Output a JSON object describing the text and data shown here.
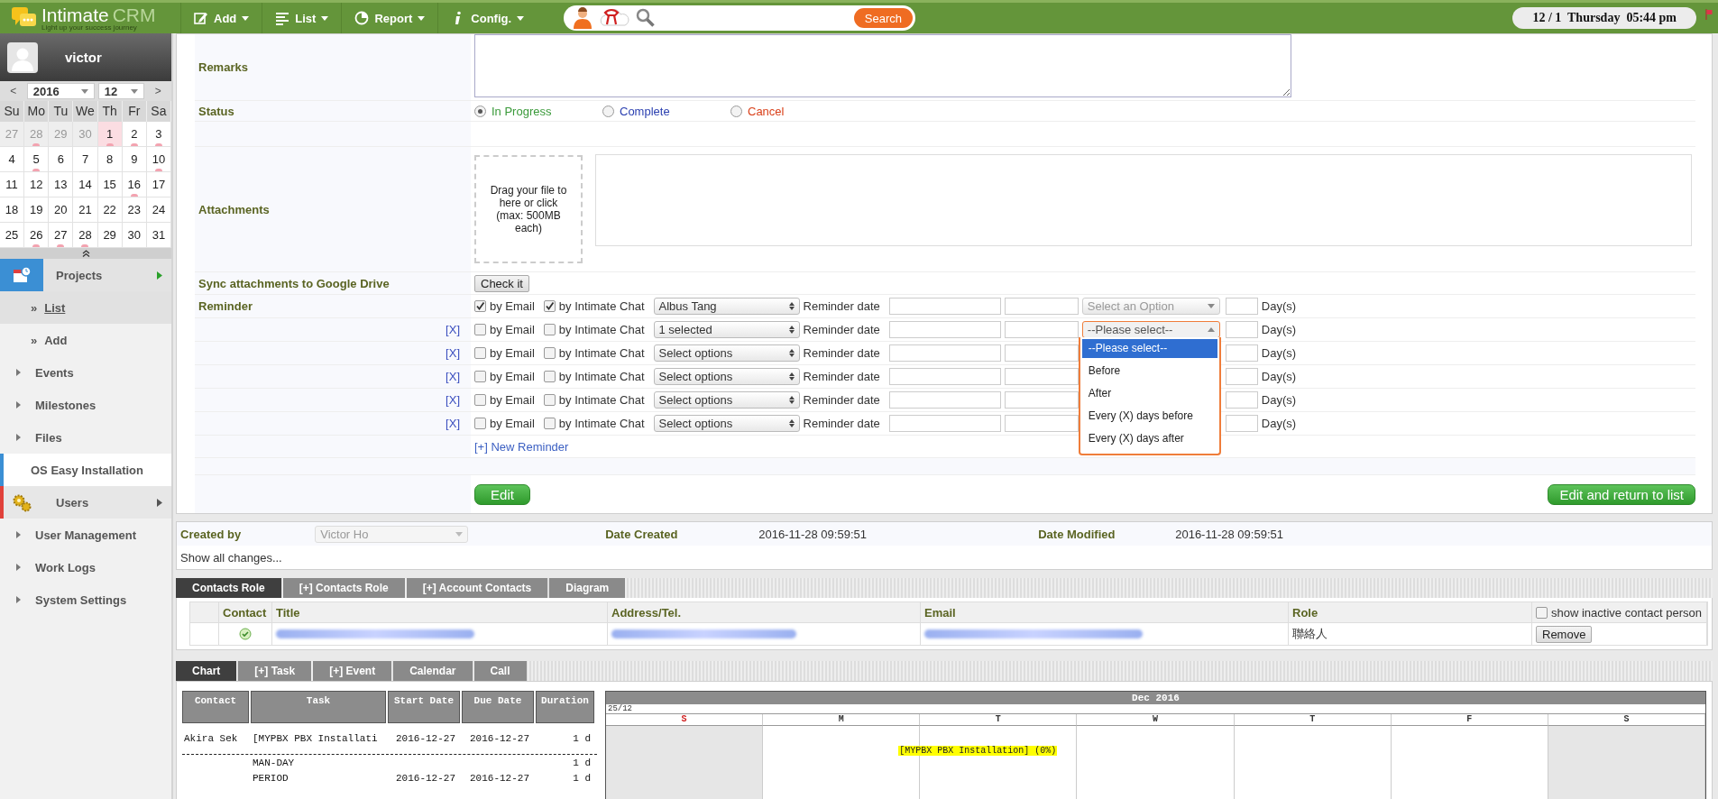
{
  "topbar": {
    "logo": {
      "name": "Intimate",
      "suffix": "CRM",
      "tagline": "Light up your success journey"
    },
    "menu": [
      {
        "label": "Add",
        "kind": "add"
      },
      {
        "label": "List",
        "kind": "list"
      },
      {
        "label": "Report",
        "kind": "report"
      },
      {
        "label": "Config.",
        "kind": "config"
      }
    ],
    "search": {
      "button": "Search"
    },
    "clock": "12 / 1  Thursday  05:44 pm"
  },
  "sidebar": {
    "user": "victor",
    "calendar": {
      "year": "2016",
      "month": "12",
      "prev": "<",
      "next": ">",
      "weekdays": [
        "Su",
        "Mo",
        "Tu",
        "We",
        "Th",
        "Fr",
        "Sa"
      ],
      "weeks": [
        [
          {
            "d": "27",
            "muted": true,
            "today": false,
            "event": false
          },
          {
            "d": "28",
            "muted": true,
            "today": false,
            "event": true
          },
          {
            "d": "29",
            "muted": true,
            "today": false,
            "event": false
          },
          {
            "d": "30",
            "muted": true,
            "today": false,
            "event": false
          },
          {
            "d": "1",
            "muted": false,
            "today": true,
            "event": true
          },
          {
            "d": "2",
            "muted": false,
            "today": false,
            "event": true
          },
          {
            "d": "3",
            "muted": false,
            "today": false,
            "event": true
          }
        ],
        [
          {
            "d": "4",
            "muted": false,
            "today": false,
            "event": false
          },
          {
            "d": "5",
            "muted": false,
            "today": false,
            "event": true
          },
          {
            "d": "6",
            "muted": false,
            "today": false,
            "event": false
          },
          {
            "d": "7",
            "muted": false,
            "today": false,
            "event": false
          },
          {
            "d": "8",
            "muted": false,
            "today": false,
            "event": false
          },
          {
            "d": "9",
            "muted": false,
            "today": false,
            "event": false
          },
          {
            "d": "10",
            "muted": false,
            "today": false,
            "event": true
          }
        ],
        [
          {
            "d": "11",
            "muted": false,
            "today": false,
            "event": false
          },
          {
            "d": "12",
            "muted": false,
            "today": false,
            "event": false
          },
          {
            "d": "13",
            "muted": false,
            "today": false,
            "event": false
          },
          {
            "d": "14",
            "muted": false,
            "today": false,
            "event": false
          },
          {
            "d": "15",
            "muted": false,
            "today": false,
            "event": false
          },
          {
            "d": "16",
            "muted": false,
            "today": false,
            "event": true
          },
          {
            "d": "17",
            "muted": false,
            "today": false,
            "event": false
          }
        ],
        [
          {
            "d": "18",
            "muted": false,
            "today": false,
            "event": false
          },
          {
            "d": "19",
            "muted": false,
            "today": false,
            "event": false
          },
          {
            "d": "20",
            "muted": false,
            "today": false,
            "event": false
          },
          {
            "d": "21",
            "muted": false,
            "today": false,
            "event": false
          },
          {
            "d": "22",
            "muted": false,
            "today": false,
            "event": false
          },
          {
            "d": "23",
            "muted": false,
            "today": false,
            "event": false
          },
          {
            "d": "24",
            "muted": false,
            "today": false,
            "event": false
          }
        ],
        [
          {
            "d": "25",
            "muted": false,
            "today": false,
            "event": false
          },
          {
            "d": "26",
            "muted": false,
            "today": false,
            "event": true
          },
          {
            "d": "27",
            "muted": false,
            "today": false,
            "event": true
          },
          {
            "d": "28",
            "muted": false,
            "today": false,
            "event": true
          },
          {
            "d": "29",
            "muted": false,
            "today": false,
            "event": false
          },
          {
            "d": "30",
            "muted": false,
            "today": false,
            "event": false
          },
          {
            "d": "31",
            "muted": false,
            "today": false,
            "event": false
          }
        ]
      ]
    },
    "items": [
      {
        "label": "Projects",
        "kind": "section",
        "expanded": true,
        "selected": false,
        "color": "#3b8fd4"
      },
      {
        "label": "List",
        "kind": "sub",
        "bullet": "»",
        "selected": true
      },
      {
        "label": "Add",
        "kind": "sub",
        "bullet": "»",
        "selected": false
      },
      {
        "label": "Events",
        "kind": "item",
        "selected": false
      },
      {
        "label": "Milestones",
        "kind": "item",
        "selected": false
      },
      {
        "label": "Files",
        "kind": "item",
        "selected": false
      },
      {
        "label": "OS Easy Installation",
        "kind": "current",
        "selected": false,
        "color": "#3b8fd4"
      },
      {
        "label": "Users",
        "kind": "section",
        "expanded": false,
        "selected": false,
        "color": "#e0413a"
      },
      {
        "label": "User Management",
        "kind": "item",
        "selected": false
      },
      {
        "label": "Work Logs",
        "kind": "item",
        "selected": false
      },
      {
        "label": "System Settings",
        "kind": "item",
        "selected": false
      }
    ]
  },
  "form": {
    "remarks": {
      "label": "Remarks"
    },
    "status": {
      "label": "Status",
      "options": [
        {
          "label": "In Progress",
          "selected": true,
          "color": "#3a9a3a"
        },
        {
          "label": "Complete",
          "selected": false,
          "color": "#2a3fb0"
        },
        {
          "label": "Cancel",
          "selected": false,
          "color": "#d9401a"
        }
      ]
    },
    "attachments": {
      "label": "Attachments",
      "dropzone": "Drag your file to here or click (max: 500MB each)"
    },
    "sync": {
      "label": "Sync attachments to Google Drive",
      "button": "Check it"
    },
    "reminder": {
      "label": "Reminder",
      "rows": [
        {
          "by_email": true,
          "email_label": "by Email",
          "by_chat": true,
          "chat_label": "by Intimate Chat",
          "recipients": "Albus Tang",
          "date_label": "Reminder date",
          "timing": "Select an Option",
          "timing_open": false,
          "days_label": "Day(s)"
        },
        {
          "remove": "[X]",
          "by_email": false,
          "email_label": "by Email",
          "by_chat": false,
          "chat_label": "by Intimate Chat",
          "recipients": "1 selected",
          "date_label": "Reminder date",
          "timing": "--Please select--",
          "timing_open": true,
          "days_label": "Day(s)"
        },
        {
          "remove": "[X]",
          "by_email": false,
          "email_label": "by Email",
          "by_chat": false,
          "chat_label": "by Intimate Chat",
          "recipients": "Select options",
          "date_label": "Reminder date",
          "days_label": "Day(s)"
        },
        {
          "remove": "[X]",
          "by_email": false,
          "email_label": "by Email",
          "by_chat": false,
          "chat_label": "by Intimate Chat",
          "recipients": "Select options",
          "date_label": "Reminder date",
          "days_label": "Day(s)"
        },
        {
          "remove": "[X]",
          "by_email": false,
          "email_label": "by Email",
          "by_chat": false,
          "chat_label": "by Intimate Chat",
          "recipients": "Select options",
          "date_label": "Reminder date",
          "days_label": "Day(s)"
        },
        {
          "remove": "[X]",
          "by_email": false,
          "email_label": "by Email",
          "by_chat": false,
          "chat_label": "by Intimate Chat",
          "recipients": "Select options",
          "date_label": "Reminder date",
          "days_label": "Day(s)"
        }
      ],
      "dropdown": [
        {
          "label": "--Please select--",
          "selected": true
        },
        {
          "label": "Before",
          "selected": false
        },
        {
          "label": "After",
          "selected": false
        },
        {
          "label": "Every (X) days before",
          "selected": false
        },
        {
          "label": "Every (X) days after",
          "selected": false
        }
      ],
      "new": "[+] New Reminder"
    },
    "buttons": [
      "Edit",
      "Edit and return to list"
    ]
  },
  "meta": {
    "created_by_label": "Created by",
    "created_by": "Victor Ho",
    "date_created_label": "Date Created",
    "date_created": "2016-11-28 09:59:51",
    "date_modified_label": "Date Modified",
    "date_modified": "2016-11-28 09:59:51",
    "changes": "Show all changes..."
  },
  "contacts": {
    "tabs": [
      {
        "label": "Contacts Role",
        "selected": true
      },
      {
        "label": "[+] Contacts Role",
        "selected": false
      },
      {
        "label": "[+] Account Contacts",
        "selected": false
      },
      {
        "label": "Diagram",
        "selected": false
      }
    ],
    "columns": [
      "Contact",
      "Title",
      "Address/Tel.",
      "Email",
      "Role"
    ],
    "inactive_label": "show inactive contact person",
    "inactive_checked": false,
    "rows": [
      {
        "active": true,
        "role": "聯絡人",
        "action": "Remove"
      }
    ]
  },
  "schedule": {
    "tabs": [
      {
        "label": "Chart",
        "selected": true
      },
      {
        "label": "[+] Task",
        "selected": false
      },
      {
        "label": "[+] Event",
        "selected": false
      },
      {
        "label": "Calendar",
        "selected": false
      },
      {
        "label": "Call",
        "selected": false
      }
    ],
    "columns": [
      "Contact",
      "Task",
      "Start Date",
      "Due Date",
      "Duration"
    ],
    "rows": [
      {
        "kind": "task",
        "cells": [
          "Akira Sek",
          "[MYPBX PBX Installati",
          "2016-12-27",
          "2016-12-27",
          "1 d"
        ]
      },
      {
        "kind": "sub",
        "cells": [
          "",
          "MAN-DAY",
          "",
          "",
          "1 d"
        ]
      },
      {
        "kind": "sub",
        "cells": [
          "",
          "PERIOD",
          "2016-12-27",
          "2016-12-27",
          "1 d"
        ]
      }
    ],
    "month": "Dec 2016",
    "week": "25/12",
    "days": [
      {
        "label": "S",
        "weekend": true,
        "color": "#d02020"
      },
      {
        "label": "M",
        "weekend": false,
        "color": "#333333"
      },
      {
        "label": "T",
        "weekend": false,
        "color": "#333333",
        "task": "[MYPBX PBX Installation] (0%)"
      },
      {
        "label": "W",
        "weekend": false,
        "color": "#333333"
      },
      {
        "label": "T",
        "weekend": false,
        "color": "#333333"
      },
      {
        "label": "F",
        "weekend": false,
        "color": "#333333"
      },
      {
        "label": "S",
        "weekend": true,
        "color": "#333333"
      }
    ]
  }
}
